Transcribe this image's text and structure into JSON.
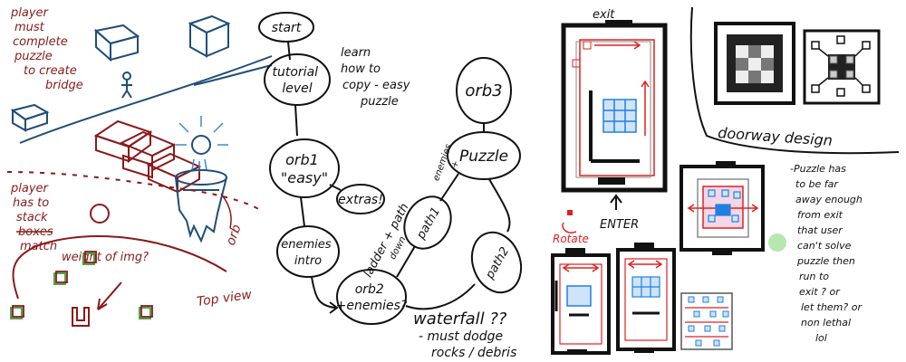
{
  "colors": {
    "ink": "#111111",
    "red": "#8a1a1a",
    "blue": "#1f4e79",
    "bright_red": "#e02020",
    "bright_blue": "#2080e0",
    "green": "#3a9a3a",
    "green_dot": "#b8e6b0",
    "gray_border": "#555555"
  },
  "left_panel": {
    "note_top": [
      "player",
      "must",
      "complete",
      "puzzle",
      "to create",
      "bridge"
    ],
    "note_bottom": [
      "player",
      "has to",
      "stack",
      "boxes",
      "match",
      "weight of img?"
    ],
    "orb_label": "orb",
    "top_view_label": "Top view"
  },
  "flowchart": {
    "start": "start",
    "tutorial": [
      "tutorial",
      "level"
    ],
    "tutorial_note": [
      "learn",
      "how to",
      "copy - easy",
      "puzzle"
    ],
    "orb1": [
      "orb1",
      "\"easy\""
    ],
    "extras": "extras!",
    "enemies_intro": [
      "enemies",
      "intro"
    ],
    "ladder_note": [
      "ladder + path",
      "down"
    ],
    "path1": "path1",
    "orb2": [
      "orb2",
      "+enemies?"
    ],
    "orb3": "orb3",
    "enemies_plus": [
      "enemies",
      "+"
    ],
    "puzzle": "Puzzle",
    "path2": "path2",
    "waterfall": [
      "waterfall ??",
      "- must dodge",
      "rocks / debris"
    ]
  },
  "right_panel": {
    "exit_label": "exit",
    "enter_label": "ENTER",
    "rotate_label": "Rotate",
    "doorway_label": "doorway design",
    "puzzle_note": [
      "-Puzzle has",
      "to be far",
      "away enough",
      "from exit",
      "that user",
      "can't solve",
      "puzzle then",
      "run to",
      "exit ? or",
      "let them? or",
      "non lethal",
      "lol"
    ]
  }
}
